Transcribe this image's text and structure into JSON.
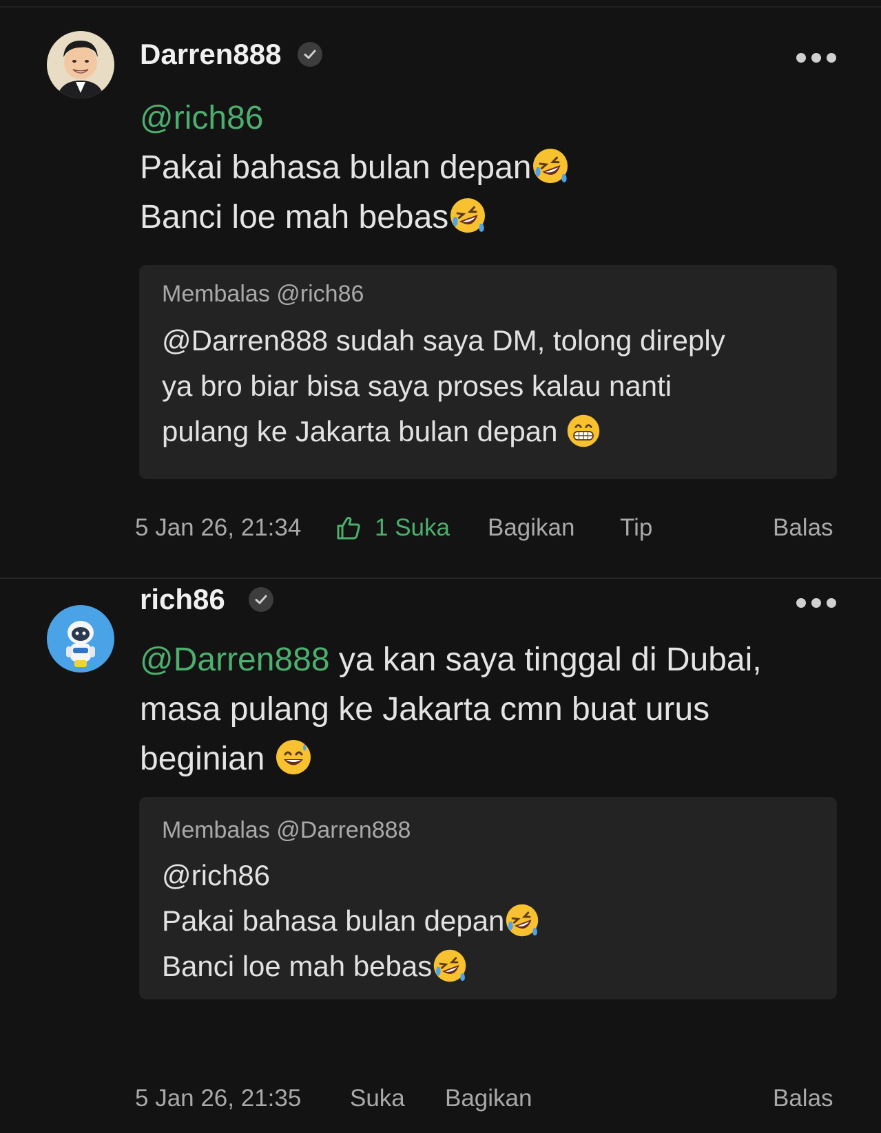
{
  "comments": [
    {
      "username": "Darren888",
      "avatar_icon": "avatar-portrait",
      "verified_icon": "verified-check-icon",
      "mention": "@rich86",
      "lines": [
        "Pakai bahasa bulan depan",
        "Banci loe mah bebas"
      ],
      "line_emojis": [
        "rolling-laughing-emoji",
        "rolling-laughing-emoji"
      ],
      "reply": {
        "label": "Membalas @rich86",
        "lines": [
          "@Darren888 sudah saya DM, tolong direply",
          "ya bro biar bisa saya proses kalau nanti",
          "pulang ke Jakarta bulan depan "
        ],
        "end_emoji": "grinning-teeth-emoji"
      },
      "footer": {
        "timestamp": "5 Jan 26, 21:34",
        "like_label": "1 Suka",
        "like_active": true,
        "share_label": "Bagikan",
        "tip_label": "Tip",
        "reply_label": "Balas"
      }
    },
    {
      "username": "rich86",
      "avatar_icon": "avatar-astronaut",
      "verified_icon": "verified-check-icon",
      "mention": "@Darren888",
      "lines": [
        " ya kan saya tinggal di Dubai,",
        "masa pulang ke Jakarta cmn buat urus",
        "beginian "
      ],
      "end_emoji": "sweat-smile-emoji",
      "reply": {
        "label": "Membalas @Darren888",
        "lines": [
          "@rich86",
          "Pakai bahasa bulan depan",
          "Banci loe mah bebas"
        ],
        "line_emojis": [
          "rolling-laughing-emoji",
          "rolling-laughing-emoji"
        ]
      },
      "footer": {
        "timestamp": "5 Jan 26, 21:35",
        "like_label": "Suka",
        "share_label": "Bagikan",
        "reply_label": "Balas"
      }
    }
  ],
  "colors": {
    "background": "#131313",
    "quote_background": "#232323",
    "mention_green": "#4caf6e",
    "muted_text": "#a9a9a9"
  }
}
